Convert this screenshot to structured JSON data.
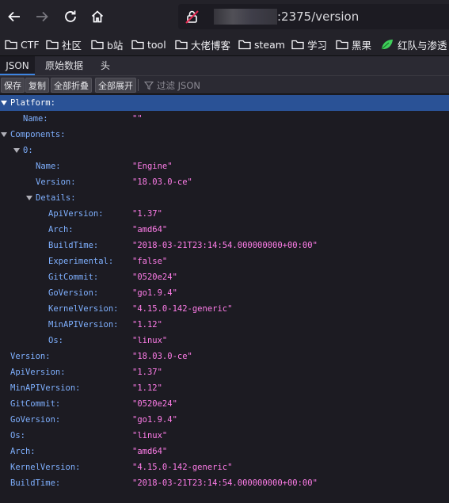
{
  "nav": {
    "url_suffix": ":2375/version"
  },
  "bookmarks": [
    {
      "label": "CTF",
      "icon": "folder-icon"
    },
    {
      "label": "社区",
      "icon": "folder-icon"
    },
    {
      "label": "b站",
      "icon": "folder-icon"
    },
    {
      "label": "tool",
      "icon": "folder-icon"
    },
    {
      "label": "大佬博客",
      "icon": "folder-icon"
    },
    {
      "label": "steam",
      "icon": "folder-icon"
    },
    {
      "label": "学习",
      "icon": "folder-icon"
    },
    {
      "label": "黑果",
      "icon": "folder-icon"
    },
    {
      "label": "红队与渗透",
      "icon": "leaf-icon"
    }
  ],
  "tabs": [
    {
      "label": "JSON",
      "active": true
    },
    {
      "label": "原始数据",
      "active": false
    },
    {
      "label": "头",
      "active": false
    }
  ],
  "toolbar": {
    "save": "保存",
    "copy": "复制",
    "collapse_all": "全部折叠",
    "expand_all": "全部展开",
    "filter_placeholder": "过滤 JSON"
  },
  "rows": [
    {
      "key": "Platform:",
      "value": "",
      "depth": 0,
      "twisty": true,
      "selected": true
    },
    {
      "key": "Name:",
      "value": "\"\"",
      "depth": 1,
      "twisty": false
    },
    {
      "key": "Components:",
      "value": "",
      "depth": 0,
      "twisty": true
    },
    {
      "key": "0:",
      "value": "",
      "depth": 1,
      "twisty": true
    },
    {
      "key": "Name:",
      "value": "\"Engine\"",
      "depth": 2,
      "twisty": false
    },
    {
      "key": "Version:",
      "value": "\"18.03.0-ce\"",
      "depth": 2,
      "twisty": false
    },
    {
      "key": "Details:",
      "value": "",
      "depth": 2,
      "twisty": true
    },
    {
      "key": "ApiVersion:",
      "value": "\"1.37\"",
      "depth": 3,
      "twisty": false
    },
    {
      "key": "Arch:",
      "value": "\"amd64\"",
      "depth": 3,
      "twisty": false
    },
    {
      "key": "BuildTime:",
      "value": "\"2018-03-21T23:14:54.000000000+00:00\"",
      "depth": 3,
      "twisty": false
    },
    {
      "key": "Experimental:",
      "value": "\"false\"",
      "depth": 3,
      "twisty": false
    },
    {
      "key": "GitCommit:",
      "value": "\"0520e24\"",
      "depth": 3,
      "twisty": false
    },
    {
      "key": "GoVersion:",
      "value": "\"go1.9.4\"",
      "depth": 3,
      "twisty": false
    },
    {
      "key": "KernelVersion:",
      "value": "\"4.15.0-142-generic\"",
      "depth": 3,
      "twisty": false
    },
    {
      "key": "MinAPIVersion:",
      "value": "\"1.12\"",
      "depth": 3,
      "twisty": false
    },
    {
      "key": "Os:",
      "value": "\"linux\"",
      "depth": 3,
      "twisty": false
    },
    {
      "key": "Version:",
      "value": "\"18.03.0-ce\"",
      "depth": 0,
      "twisty": false
    },
    {
      "key": "ApiVersion:",
      "value": "\"1.37\"",
      "depth": 0,
      "twisty": false
    },
    {
      "key": "MinAPIVersion:",
      "value": "\"1.12\"",
      "depth": 0,
      "twisty": false
    },
    {
      "key": "GitCommit:",
      "value": "\"0520e24\"",
      "depth": 0,
      "twisty": false
    },
    {
      "key": "GoVersion:",
      "value": "\"go1.9.4\"",
      "depth": 0,
      "twisty": false
    },
    {
      "key": "Os:",
      "value": "\"linux\"",
      "depth": 0,
      "twisty": false
    },
    {
      "key": "Arch:",
      "value": "\"amd64\"",
      "depth": 0,
      "twisty": false
    },
    {
      "key": "KernelVersion:",
      "value": "\"4.15.0-142-generic\"",
      "depth": 0,
      "twisty": false
    },
    {
      "key": "BuildTime:",
      "value": "\"2018-03-21T23:14:54.000000000+00:00\"",
      "depth": 0,
      "twisty": false
    }
  ],
  "colors": {
    "key": "#7fb0ff",
    "value": "#ff7de9",
    "selection": "#2a5296",
    "background": "#1c1b22"
  }
}
